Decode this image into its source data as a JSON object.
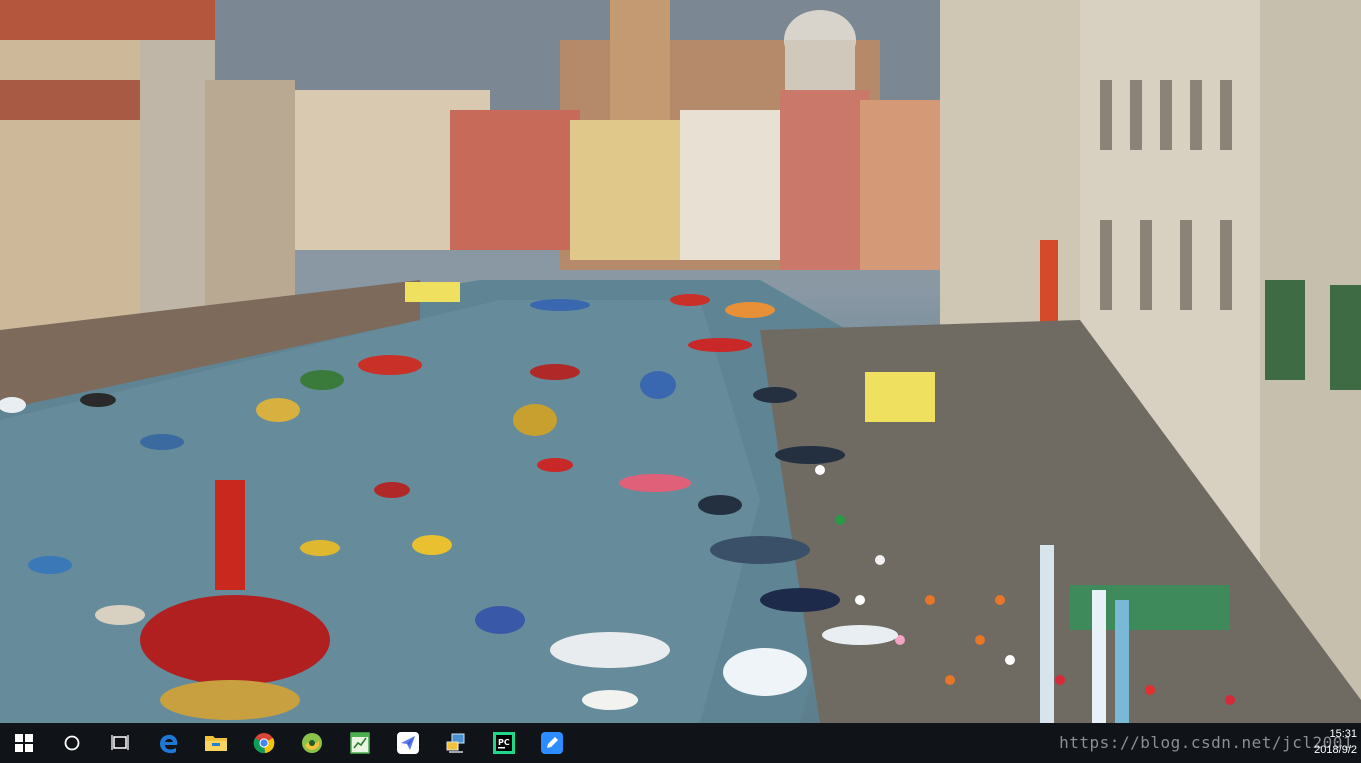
{
  "wallpaper": {
    "description_icon": "venice-grand-canal-regatta-photo"
  },
  "taskbar": {
    "start_icon": "windows-logo-icon",
    "search_icon": "cortana-circle-icon",
    "taskview_icon": "task-view-icon",
    "apps": [
      {
        "name": "edge-icon"
      },
      {
        "name": "file-explorer-icon"
      },
      {
        "name": "chrome-icon"
      },
      {
        "name": "app-green-circle-icon"
      },
      {
        "name": "notepad-chart-icon"
      },
      {
        "name": "paper-plane-app-icon"
      },
      {
        "name": "network-computer-icon"
      },
      {
        "name": "pycharm-icon"
      },
      {
        "name": "blue-pencil-app-icon"
      }
    ],
    "watermark": "https://blog.csdn.net/jcl2001",
    "clock": {
      "time": "15:31",
      "date": "2018/9/2"
    }
  },
  "colors": {
    "taskbar_bg": "#101418",
    "edge_blue": "#1e78d6",
    "folder_yellow": "#f2c23b",
    "pycharm_green": "#21d789"
  }
}
